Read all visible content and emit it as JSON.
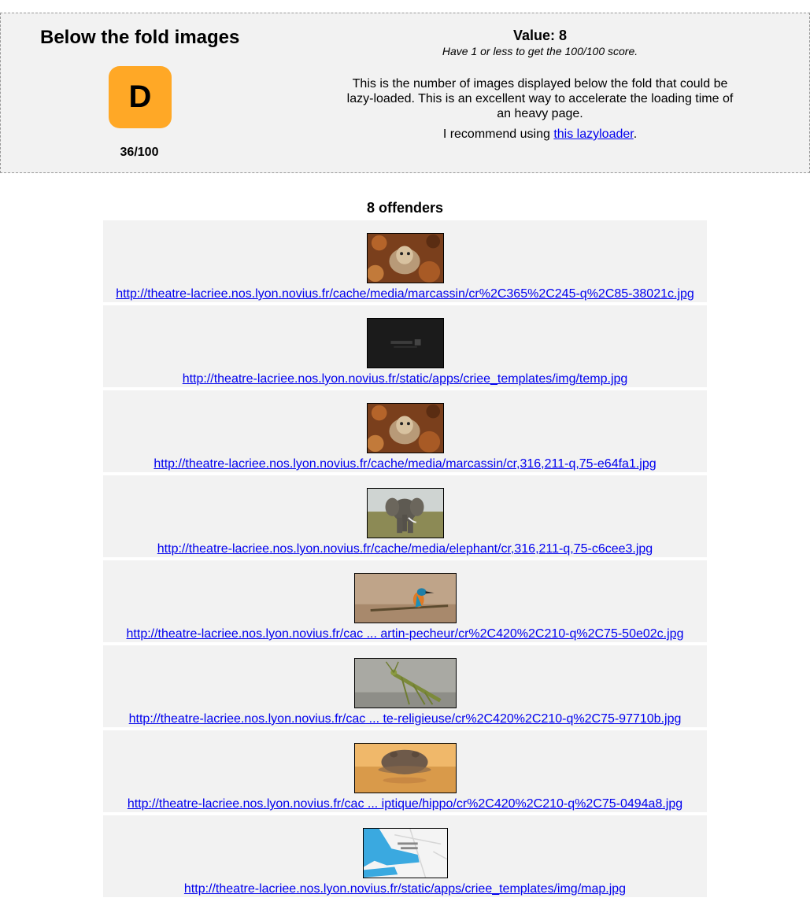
{
  "summary": {
    "title": "Below the fold images",
    "grade": "D",
    "score": "36/100",
    "value": "Value: 8",
    "value_hint": "Have 1 or less to get the 100/100 score.",
    "description": "This is the number of images displayed below the fold that could be lazy-loaded. This is an excellent way to accelerate the loading time of an heavy page.",
    "recommend_prefix": "I recommend using ",
    "recommend_link": "this lazyloader",
    "recommend_suffix": ".",
    "grade_color": "#ffa826"
  },
  "offenders": {
    "title": "8 offenders",
    "items": [
      {
        "url": "http://theatre-lacriee.nos.lyon.novius.fr/cache/media/marcassin/cr%2C365%2C245-q%2C85-38021c.jpg",
        "image": "boar-piglet"
      },
      {
        "url": "http://theatre-lacriee.nos.lyon.novius.fr/static/apps/criee_templates/img/temp.jpg",
        "image": "dark-logo"
      },
      {
        "url": "http://theatre-lacriee.nos.lyon.novius.fr/cache/media/marcassin/cr,316,211-q,75-e64fa1.jpg",
        "image": "boar-piglet"
      },
      {
        "url": "http://theatre-lacriee.nos.lyon.novius.fr/cache/media/elephant/cr,316,211-q,75-c6cee3.jpg",
        "image": "elephant"
      },
      {
        "url": "http://theatre-lacriee.nos.lyon.novius.fr/cac ... artin-pecheur/cr%2C420%2C210-q%2C75-50e02c.jpg",
        "image": "kingfisher"
      },
      {
        "url": "http://theatre-lacriee.nos.lyon.novius.fr/cac ... te-religieuse/cr%2C420%2C210-q%2C75-97710b.jpg",
        "image": "praying-mantis"
      },
      {
        "url": "http://theatre-lacriee.nos.lyon.novius.fr/cac ... iptique/hippo/cr%2C420%2C210-q%2C75-0494a8.jpg",
        "image": "hippo"
      },
      {
        "url": "http://theatre-lacriee.nos.lyon.novius.fr/static/apps/criee_templates/img/map.jpg",
        "image": "map"
      }
    ]
  }
}
